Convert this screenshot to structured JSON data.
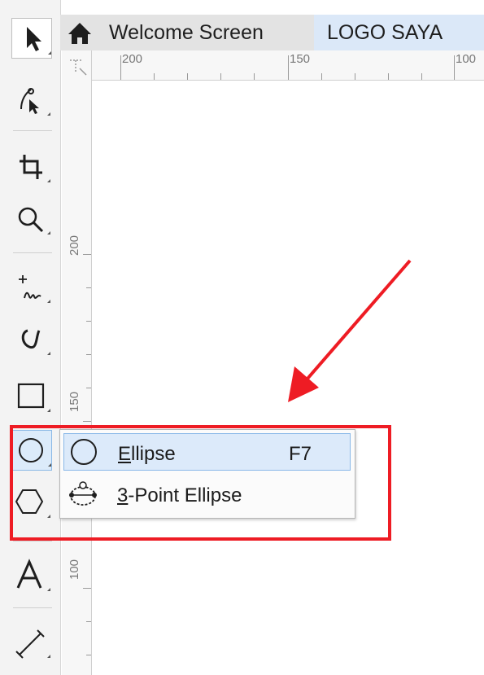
{
  "tabs": {
    "welcome_label": "Welcome Screen",
    "document_label": "LOGO SAYA",
    "active_color": "#dbe8f8"
  },
  "rulers": {
    "top_labels": [
      "200",
      "150",
      "100"
    ],
    "left_labels": [
      "200",
      "150",
      "100"
    ]
  },
  "toolbox": {
    "tools": [
      {
        "name": "pick-tool",
        "icon": "arrow-pointer-icon",
        "state": "selected"
      },
      {
        "name": "shape-tool",
        "icon": "node-shape-icon"
      },
      {
        "name": "crop-tool",
        "icon": "crop-icon"
      },
      {
        "name": "zoom-tool",
        "icon": "magnifier-icon"
      },
      {
        "name": "freehand-tool",
        "icon": "freehand-icon"
      },
      {
        "name": "artistic-media-tool",
        "icon": "artistic-media-icon"
      },
      {
        "name": "rectangle-tool",
        "icon": "rectangle-icon"
      },
      {
        "name": "ellipse-tool",
        "icon": "ellipse-icon",
        "state": "active"
      },
      {
        "name": "polygon-tool",
        "icon": "hexagon-icon"
      },
      {
        "name": "text-tool",
        "icon": "text-a-icon"
      },
      {
        "name": "dimension-tool",
        "icon": "dimension-line-icon"
      }
    ]
  },
  "flyout": {
    "ellipse": {
      "mnemonic": "E",
      "rest": "llipse",
      "shortcut": "F7"
    },
    "three_point": {
      "mnemonic": "3",
      "rest": "-Point Ellipse"
    }
  },
  "annotation": {
    "color": "#ee1c24"
  }
}
